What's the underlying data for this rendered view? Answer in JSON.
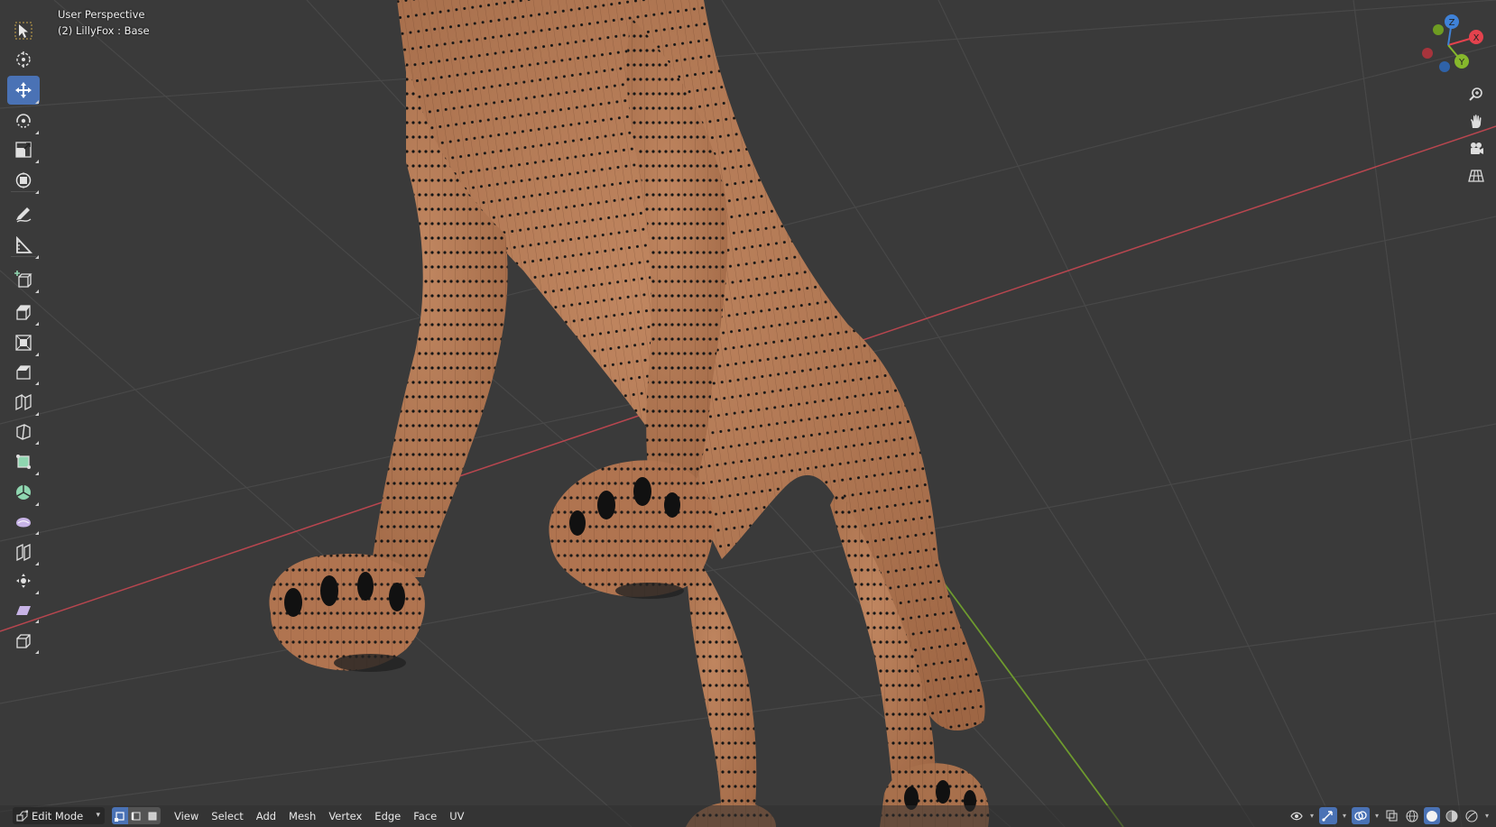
{
  "viewport": {
    "title": "User Perspective",
    "subtitle": "(2) LillyFox : Base",
    "colors": {
      "background": "#3a3a3a",
      "grid": "#4a4a4a",
      "x_axis": "#b8464f",
      "y_axis": "#6e9a2e",
      "mesh_skin": "#b57850",
      "vertex": "#111111"
    }
  },
  "toolbar": {
    "tools": [
      {
        "name": "select-box-tool",
        "icon": "cursor-icon",
        "active": false
      },
      {
        "name": "cursor-tool",
        "icon": "crosshair-icon",
        "active": false
      },
      {
        "name": "move-tool",
        "icon": "move-arrows-icon",
        "active": true
      },
      {
        "name": "rotate-tool",
        "icon": "rotate-icon",
        "active": false
      },
      {
        "name": "scale-tool",
        "icon": "scale-icon",
        "active": false
      },
      {
        "name": "transform-tool",
        "icon": "transform-icon",
        "active": false
      },
      {
        "name": "annotate-tool",
        "icon": "pencil-icon",
        "active": false
      },
      {
        "name": "measure-tool",
        "icon": "ruler-icon",
        "active": false
      },
      {
        "name": "add-cube-tool",
        "icon": "add-cube-icon",
        "active": false
      },
      {
        "name": "extrude-tool",
        "icon": "extrude-icon",
        "active": false
      },
      {
        "name": "inset-tool",
        "icon": "inset-icon",
        "active": false
      },
      {
        "name": "bevel-tool",
        "icon": "bevel-icon",
        "active": false
      },
      {
        "name": "loop-cut-tool",
        "icon": "loop-cut-icon",
        "active": false
      },
      {
        "name": "knife-tool",
        "icon": "knife-icon",
        "active": false
      },
      {
        "name": "poly-build-tool",
        "icon": "poly-build-icon",
        "active": false
      },
      {
        "name": "spin-tool",
        "icon": "spin-icon",
        "active": false
      },
      {
        "name": "smooth-tool",
        "icon": "smooth-icon",
        "active": false
      },
      {
        "name": "edge-slide-tool",
        "icon": "edge-slide-icon",
        "active": false
      },
      {
        "name": "shrink-fatten-tool",
        "icon": "shrink-fatten-icon",
        "active": false
      },
      {
        "name": "shear-tool",
        "icon": "shear-icon",
        "active": false
      },
      {
        "name": "rip-region-tool",
        "icon": "rip-icon",
        "active": false
      }
    ]
  },
  "gizmo": {
    "x_label": "X",
    "y_label": "Y",
    "z_label": "Z",
    "colors": {
      "x": "#e4424d",
      "y": "#86b82c",
      "z": "#3f82d8"
    }
  },
  "nav_buttons": [
    {
      "name": "zoom-button",
      "icon": "zoom-icon"
    },
    {
      "name": "pan-button",
      "icon": "hand-icon"
    },
    {
      "name": "camera-view-button",
      "icon": "camera-icon"
    },
    {
      "name": "ortho-toggle-button",
      "icon": "grid-icon"
    }
  ],
  "header": {
    "mode": "Edit Mode",
    "select_modes": [
      "vertex",
      "edge",
      "face"
    ],
    "menus": [
      "View",
      "Select",
      "Add",
      "Mesh",
      "Vertex",
      "Edge",
      "Face",
      "UV"
    ],
    "right_icons": [
      "visibility-icon",
      "gizmo-icon",
      "overlay-icon",
      "xray-icon",
      "wireframe-shading-icon",
      "solid-shading-icon",
      "material-shading-icon",
      "rendered-shading-icon"
    ]
  }
}
